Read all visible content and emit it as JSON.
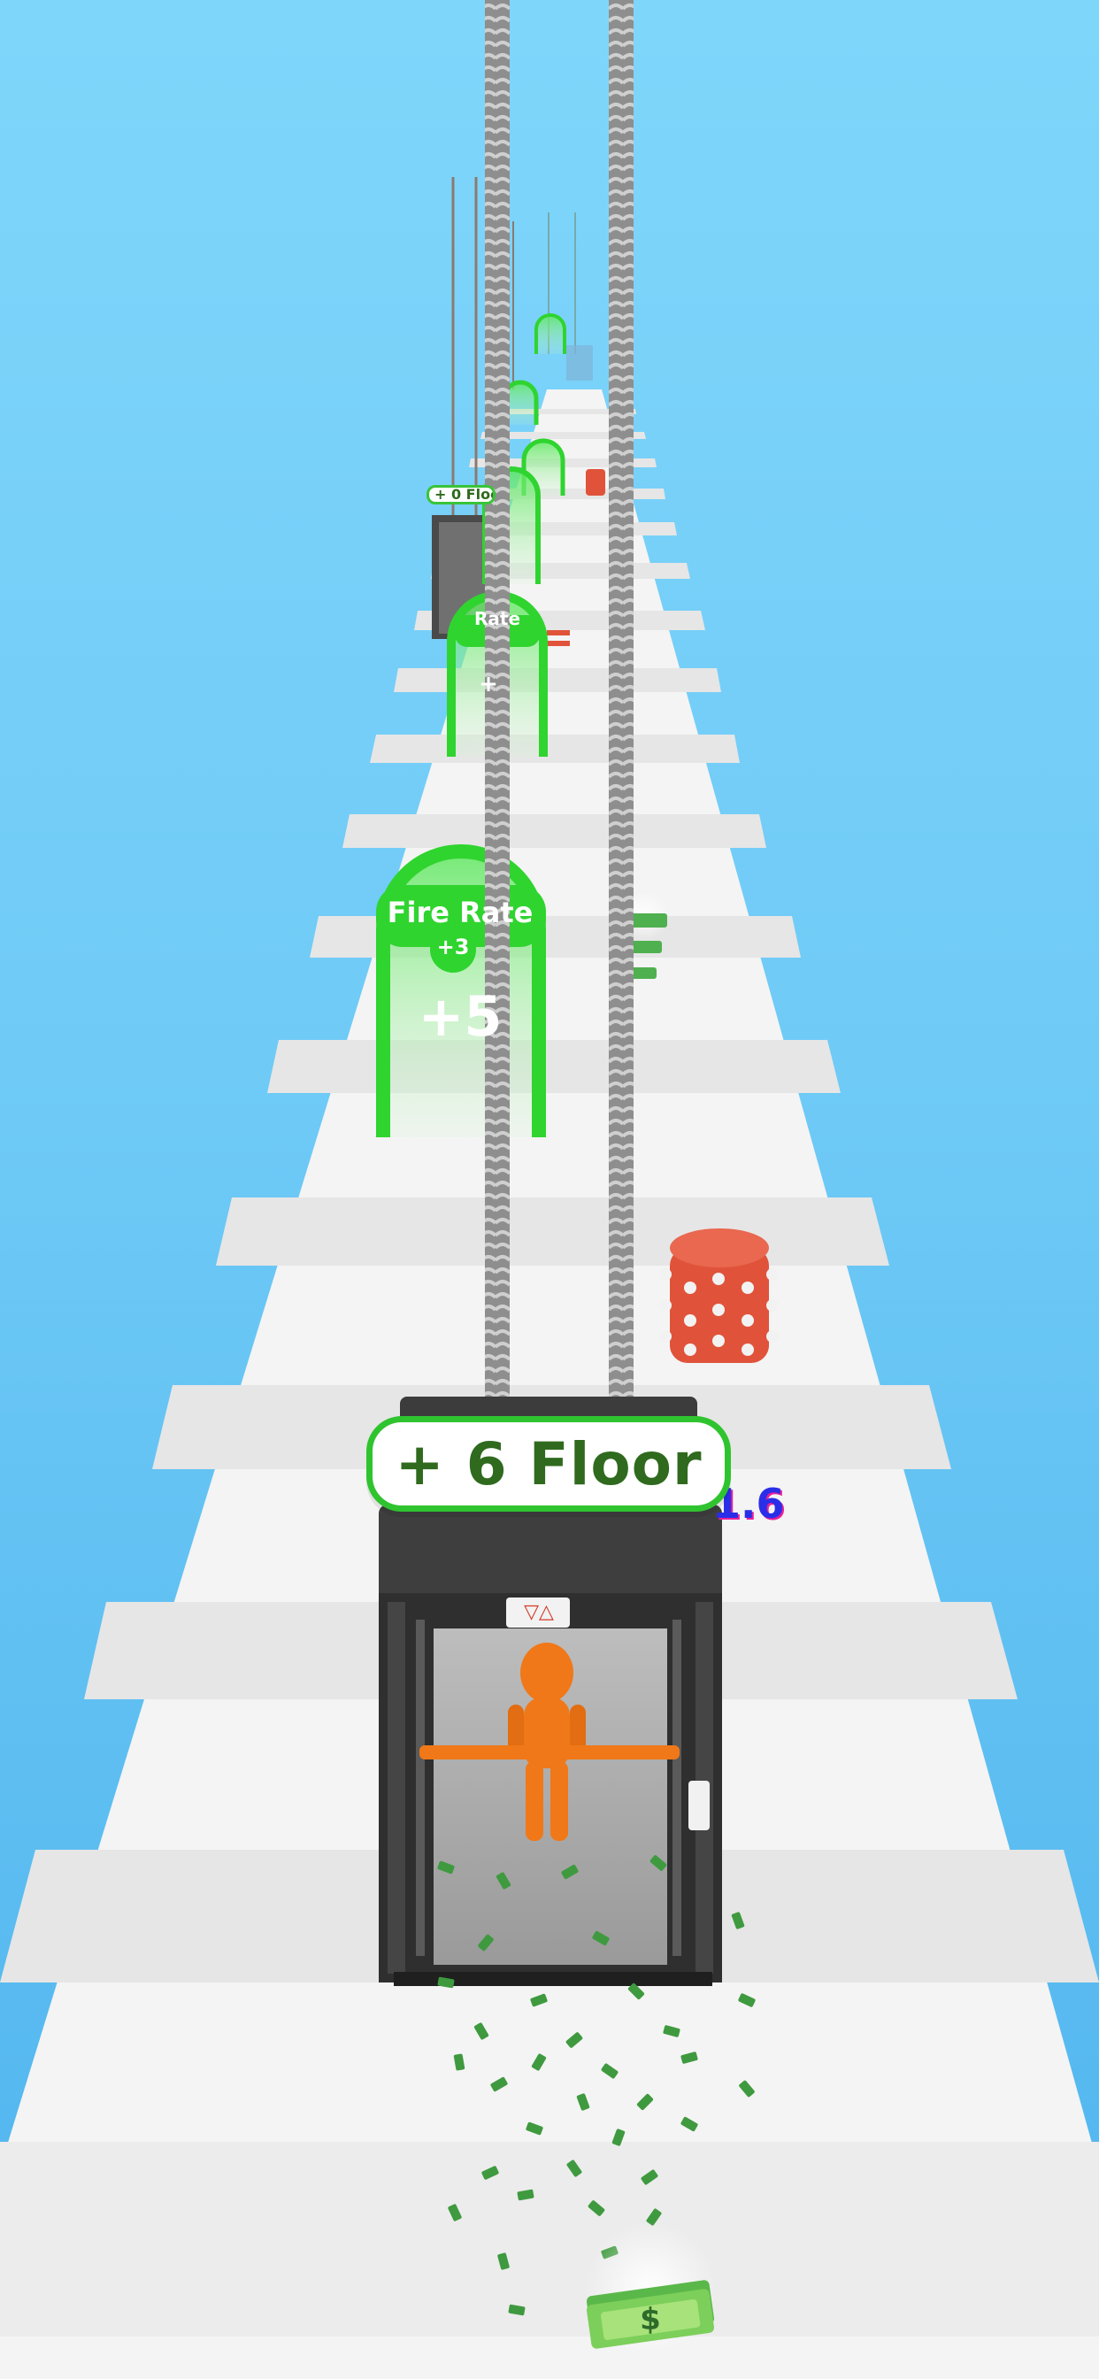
{
  "hud": {
    "floor_banner": "+ 6 Floor",
    "score_partial": "1.6"
  },
  "gates": [
    {
      "title": "Fire Rate",
      "subtitle": "+3",
      "value": "+5"
    },
    {
      "title": "Rate",
      "value": "+"
    }
  ],
  "far_floor_label": "+ 0 Floo",
  "elevator": {
    "indicator": "▽△"
  },
  "colors": {
    "sky": "#7fd6fb",
    "runway_light": "#ffffff",
    "runway_stripe": "#e6e6e6",
    "gate_green": "#2fd42f",
    "player": "#f07818",
    "elevator": "#3a3a3a",
    "spike_drum": "#e0533a",
    "cash": "#3f9a3f"
  },
  "icons": [
    "dollar-icon",
    "up-down-arrow-icon"
  ]
}
